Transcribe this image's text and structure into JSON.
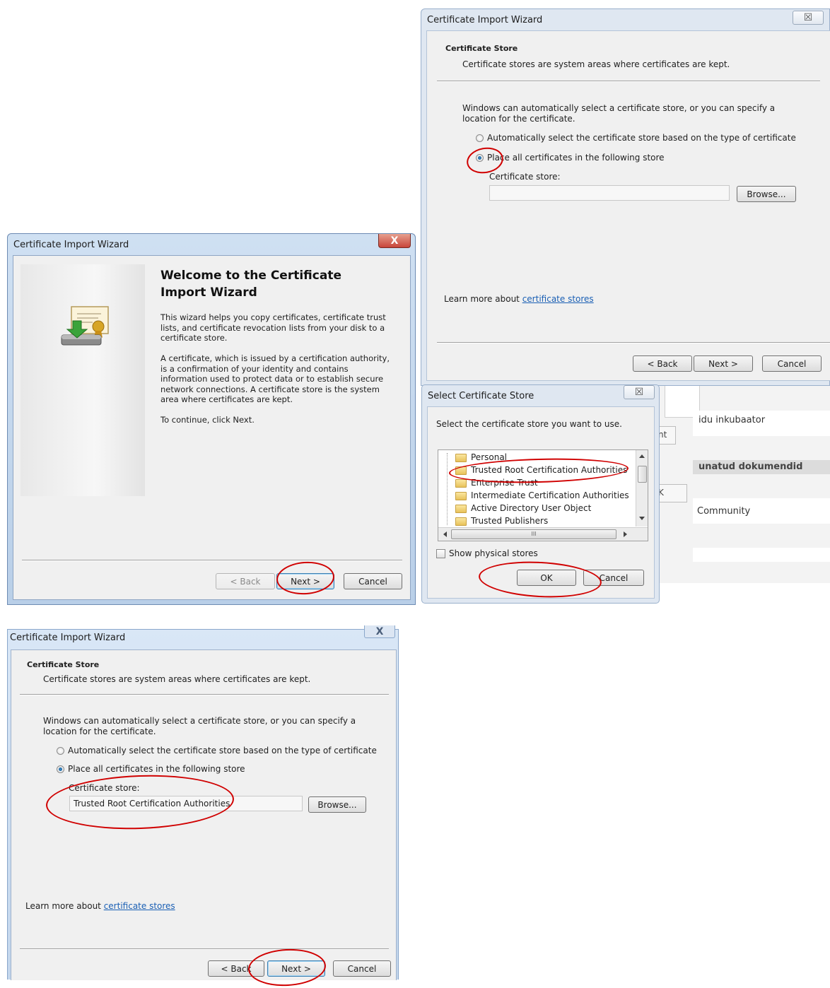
{
  "welcome_wizard": {
    "title": "Certificate Import Wizard",
    "close_label": "X",
    "heading": "Welcome to the Certificate Import Wizard",
    "para1": "This wizard helps you copy certificates, certificate trust lists, and certificate revocation lists from your disk to a certificate store.",
    "para2": "A certificate, which is issued by a certification authority, is a confirmation of your identity and contains information used to protect data or to establish secure network connections. A certificate store is the system area where certificates are kept.",
    "para3": "To continue, click Next.",
    "back_label": "< Back",
    "next_label": "Next >",
    "cancel_label": "Cancel"
  },
  "store_wizard_top": {
    "title": "Certificate Import Wizard",
    "close_label": "☒",
    "section_title": "Certificate Store",
    "section_desc": "Certificate stores are system areas where certificates are kept.",
    "intro": "Windows can automatically select a certificate store, or you can specify a location for the certificate.",
    "radio_auto": "Automatically select the certificate store based on the type of certificate",
    "radio_place": "Place all certificates in the following store",
    "store_label": "Certificate store:",
    "store_value": "",
    "browse_label": "Browse...",
    "learn_prefix": "Learn more about ",
    "learn_link": "certificate stores",
    "back_label": "< Back",
    "next_label": "Next >",
    "cancel_label": "Cancel"
  },
  "select_store": {
    "title": "Select Certificate Store",
    "close_label": "☒",
    "prompt": "Select the certificate store you want to use.",
    "items": [
      "Personal",
      "Trusted Root Certification Authorities",
      "Enterprise Trust",
      "Intermediate Certification Authorities",
      "Active Directory User Object",
      "Trusted Publishers"
    ],
    "show_physical": "Show physical stores",
    "ok_label": "OK",
    "cancel_label": "Cancel",
    "scroll_mid": "III"
  },
  "background_page": {
    "text1": "idu inkubaator",
    "text2": "unatud dokumendid",
    "text3": "Community",
    "frag_nt": "nt",
    "frag_k": "K"
  },
  "store_wizard_bottom": {
    "title": "Certificate Import Wizard",
    "close_label": "X",
    "section_title": "Certificate Store",
    "section_desc": "Certificate stores are system areas where certificates are kept.",
    "intro": "Windows can automatically select a certificate store, or you can specify a location for the certificate.",
    "radio_auto": "Automatically select the certificate store based on the type of certificate",
    "radio_place": "Place all certificates in the following store",
    "store_label": "Certificate store:",
    "store_value": "Trusted Root Certification Authorities",
    "browse_label": "Browse...",
    "learn_prefix": "Learn more about ",
    "learn_link": "certificate stores",
    "back_label": "< Back",
    "next_label": "Next >",
    "cancel_label": "Cancel"
  },
  "colors": {
    "aero_frame": "#c4d7ed",
    "client_bg": "#f0f0f0",
    "link": "#1a5fb4",
    "annotation": "#d00000",
    "close_red": "#c8453a"
  }
}
